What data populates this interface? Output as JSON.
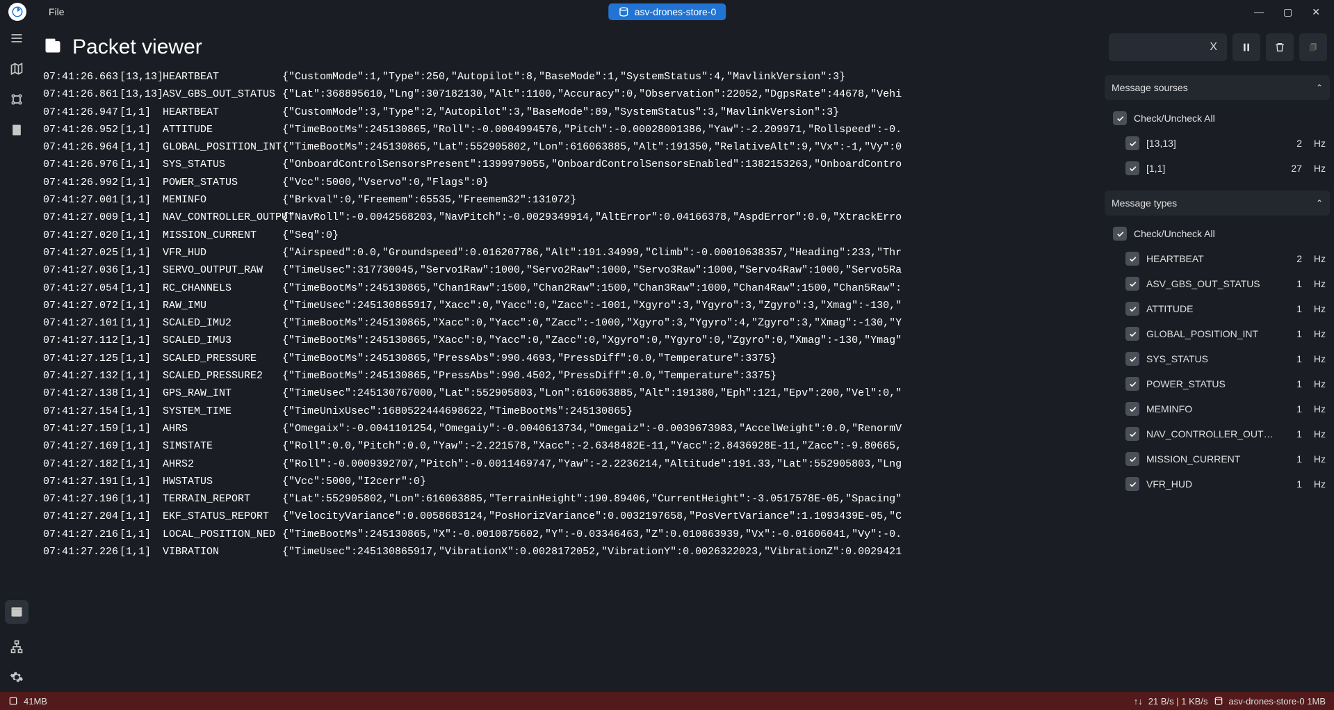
{
  "titlebar": {
    "file_menu": "File",
    "store_label": "asv-drones-store-0"
  },
  "page": {
    "title": "Packet viewer",
    "clear_x": "X"
  },
  "packets": [
    {
      "t": "07:41:26.663",
      "s": "[13,13]",
      "n": "HEARTBEAT",
      "j": "{\"CustomMode\":1,\"Type\":250,\"Autopilot\":8,\"BaseMode\":1,\"SystemStatus\":4,\"MavlinkVersion\":3}"
    },
    {
      "t": "07:41:26.861",
      "s": "[13,13]",
      "n": "ASV_GBS_OUT_STATUS",
      "j": "{\"Lat\":368895610,\"Lng\":307182130,\"Alt\":1100,\"Accuracy\":0,\"Observation\":22052,\"DgpsRate\":44678,\"Vehi"
    },
    {
      "t": "07:41:26.947",
      "s": "[1,1]",
      "n": "HEARTBEAT",
      "j": "{\"CustomMode\":3,\"Type\":2,\"Autopilot\":3,\"BaseMode\":89,\"SystemStatus\":3,\"MavlinkVersion\":3}"
    },
    {
      "t": "07:41:26.952",
      "s": "[1,1]",
      "n": "ATTITUDE",
      "j": "{\"TimeBootMs\":245130865,\"Roll\":-0.0004994576,\"Pitch\":-0.00028001386,\"Yaw\":-2.209971,\"Rollspeed\":-0."
    },
    {
      "t": "07:41:26.964",
      "s": "[1,1]",
      "n": "GLOBAL_POSITION_INT",
      "j": "{\"TimeBootMs\":245130865,\"Lat\":552905802,\"Lon\":616063885,\"Alt\":191350,\"RelativeAlt\":9,\"Vx\":-1,\"Vy\":0"
    },
    {
      "t": "07:41:26.976",
      "s": "[1,1]",
      "n": "SYS_STATUS",
      "j": "{\"OnboardControlSensorsPresent\":1399979055,\"OnboardControlSensorsEnabled\":1382153263,\"OnboardContro"
    },
    {
      "t": "07:41:26.992",
      "s": "[1,1]",
      "n": "POWER_STATUS",
      "j": "{\"Vcc\":5000,\"Vservo\":0,\"Flags\":0}"
    },
    {
      "t": "07:41:27.001",
      "s": "[1,1]",
      "n": "MEMINFO",
      "j": "{\"Brkval\":0,\"Freemem\":65535,\"Freemem32\":131072}"
    },
    {
      "t": "07:41:27.009",
      "s": "[1,1]",
      "n": "NAV_CONTROLLER_OUTPUT",
      "j": "{\"NavRoll\":-0.0042568203,\"NavPitch\":-0.0029349914,\"AltError\":0.04166378,\"AspdError\":0.0,\"XtrackErro"
    },
    {
      "t": "07:41:27.020",
      "s": "[1,1]",
      "n": "MISSION_CURRENT",
      "j": "{\"Seq\":0}"
    },
    {
      "t": "07:41:27.025",
      "s": "[1,1]",
      "n": "VFR_HUD",
      "j": "{\"Airspeed\":0.0,\"Groundspeed\":0.016207786,\"Alt\":191.34999,\"Climb\":-0.00010638357,\"Heading\":233,\"Thr"
    },
    {
      "t": "07:41:27.036",
      "s": "[1,1]",
      "n": "SERVO_OUTPUT_RAW",
      "j": "{\"TimeUsec\":317730045,\"Servo1Raw\":1000,\"Servo2Raw\":1000,\"Servo3Raw\":1000,\"Servo4Raw\":1000,\"Servo5Ra"
    },
    {
      "t": "07:41:27.054",
      "s": "[1,1]",
      "n": "RC_CHANNELS",
      "j": "{\"TimeBootMs\":245130865,\"Chan1Raw\":1500,\"Chan2Raw\":1500,\"Chan3Raw\":1000,\"Chan4Raw\":1500,\"Chan5Raw\":"
    },
    {
      "t": "07:41:27.072",
      "s": "[1,1]",
      "n": "RAW_IMU",
      "j": "{\"TimeUsec\":245130865917,\"Xacc\":0,\"Yacc\":0,\"Zacc\":-1001,\"Xgyro\":3,\"Ygyro\":3,\"Zgyro\":3,\"Xmag\":-130,\""
    },
    {
      "t": "07:41:27.101",
      "s": "[1,1]",
      "n": "SCALED_IMU2",
      "j": "{\"TimeBootMs\":245130865,\"Xacc\":0,\"Yacc\":0,\"Zacc\":-1000,\"Xgyro\":3,\"Ygyro\":4,\"Zgyro\":3,\"Xmag\":-130,\"Y"
    },
    {
      "t": "07:41:27.112",
      "s": "[1,1]",
      "n": "SCALED_IMU3",
      "j": "{\"TimeBootMs\":245130865,\"Xacc\":0,\"Yacc\":0,\"Zacc\":0,\"Xgyro\":0,\"Ygyro\":0,\"Zgyro\":0,\"Xmag\":-130,\"Ymag\""
    },
    {
      "t": "07:41:27.125",
      "s": "[1,1]",
      "n": "SCALED_PRESSURE",
      "j": "{\"TimeBootMs\":245130865,\"PressAbs\":990.4693,\"PressDiff\":0.0,\"Temperature\":3375}"
    },
    {
      "t": "07:41:27.132",
      "s": "[1,1]",
      "n": "SCALED_PRESSURE2",
      "j": "{\"TimeBootMs\":245130865,\"PressAbs\":990.4502,\"PressDiff\":0.0,\"Temperature\":3375}"
    },
    {
      "t": "07:41:27.138",
      "s": "[1,1]",
      "n": "GPS_RAW_INT",
      "j": "{\"TimeUsec\":245130767000,\"Lat\":552905803,\"Lon\":616063885,\"Alt\":191380,\"Eph\":121,\"Epv\":200,\"Vel\":0,\""
    },
    {
      "t": "07:41:27.154",
      "s": "[1,1]",
      "n": "SYSTEM_TIME",
      "j": "{\"TimeUnixUsec\":1680522444698622,\"TimeBootMs\":245130865}"
    },
    {
      "t": "07:41:27.159",
      "s": "[1,1]",
      "n": "AHRS",
      "j": "{\"Omegaix\":-0.0041101254,\"Omegaiy\":-0.0040613734,\"Omegaiz\":-0.0039673983,\"AccelWeight\":0.0,\"RenormV"
    },
    {
      "t": "07:41:27.169",
      "s": "[1,1]",
      "n": "SIMSTATE",
      "j": "{\"Roll\":0.0,\"Pitch\":0.0,\"Yaw\":-2.221578,\"Xacc\":-2.6348482E-11,\"Yacc\":2.8436928E-11,\"Zacc\":-9.80665,"
    },
    {
      "t": "07:41:27.182",
      "s": "[1,1]",
      "n": "AHRS2",
      "j": "{\"Roll\":-0.0009392707,\"Pitch\":-0.0011469747,\"Yaw\":-2.2236214,\"Altitude\":191.33,\"Lat\":552905803,\"Lng"
    },
    {
      "t": "07:41:27.191",
      "s": "[1,1]",
      "n": "HWSTATUS",
      "j": "{\"Vcc\":5000,\"I2cerr\":0}"
    },
    {
      "t": "07:41:27.196",
      "s": "[1,1]",
      "n": "TERRAIN_REPORT",
      "j": "{\"Lat\":552905802,\"Lon\":616063885,\"TerrainHeight\":190.89406,\"CurrentHeight\":-3.0517578E-05,\"Spacing\""
    },
    {
      "t": "07:41:27.204",
      "s": "[1,1]",
      "n": "EKF_STATUS_REPORT",
      "j": "{\"VelocityVariance\":0.0058683124,\"PosHorizVariance\":0.0032197658,\"PosVertVariance\":1.1093439E-05,\"C"
    },
    {
      "t": "07:41:27.216",
      "s": "[1,1]",
      "n": "LOCAL_POSITION_NED",
      "j": "{\"TimeBootMs\":245130865,\"X\":-0.0010875602,\"Y\":-0.03346463,\"Z\":0.010863939,\"Vx\":-0.01606041,\"Vy\":-0."
    },
    {
      "t": "07:41:27.226",
      "s": "[1,1]",
      "n": "VIBRATION",
      "j": "{\"TimeUsec\":245130865917,\"VibrationX\":0.0028172052,\"VibrationY\":0.0026322023,\"VibrationZ\":0.0029421"
    }
  ],
  "sources": {
    "title": "Message sourses",
    "check_all": "Check/Uncheck All",
    "items": [
      {
        "label": "[13,13]",
        "hz": "2",
        "unit": "Hz"
      },
      {
        "label": "[1,1]",
        "hz": "27",
        "unit": "Hz"
      }
    ]
  },
  "types": {
    "title": "Message types",
    "check_all": "Check/Uncheck All",
    "items": [
      {
        "label": "HEARTBEAT",
        "hz": "2",
        "unit": "Hz"
      },
      {
        "label": "ASV_GBS_OUT_STATUS",
        "hz": "1",
        "unit": "Hz"
      },
      {
        "label": "ATTITUDE",
        "hz": "1",
        "unit": "Hz"
      },
      {
        "label": "GLOBAL_POSITION_INT",
        "hz": "1",
        "unit": "Hz"
      },
      {
        "label": "SYS_STATUS",
        "hz": "1",
        "unit": "Hz"
      },
      {
        "label": "POWER_STATUS",
        "hz": "1",
        "unit": "Hz"
      },
      {
        "label": "MEMINFO",
        "hz": "1",
        "unit": "Hz"
      },
      {
        "label": "NAV_CONTROLLER_OUTPUT",
        "hz": "1",
        "unit": "Hz"
      },
      {
        "label": "MISSION_CURRENT",
        "hz": "1",
        "unit": "Hz"
      },
      {
        "label": "VFR_HUD",
        "hz": "1",
        "unit": "Hz"
      }
    ]
  },
  "status": {
    "mem": "41MB",
    "rate": "21 B/s | 1  KB/s",
    "store": "asv-drones-store-0 1MB"
  }
}
